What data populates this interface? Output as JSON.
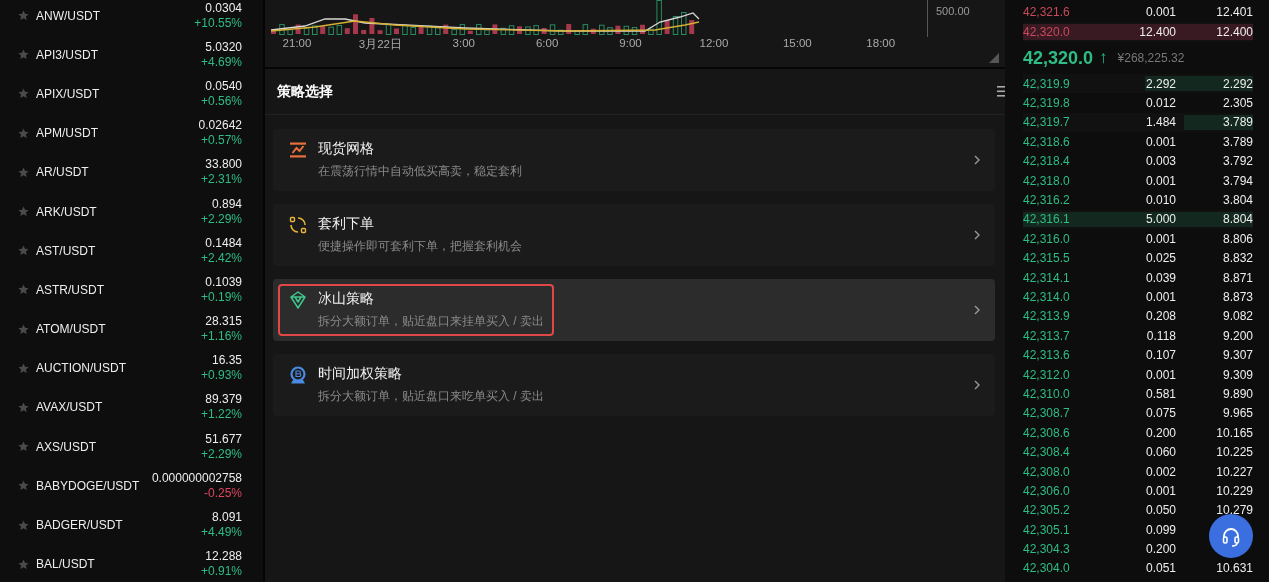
{
  "pairs": [
    {
      "name": "ANW/USDT",
      "price": "0.0304",
      "change": "+10.55%",
      "rising": true
    },
    {
      "name": "API3/USDT",
      "price": "5.0320",
      "change": "+4.69%",
      "rising": true
    },
    {
      "name": "APIX/USDT",
      "price": "0.0540",
      "change": "+0.56%",
      "rising": true
    },
    {
      "name": "APM/USDT",
      "price": "0.02642",
      "change": "+0.57%",
      "rising": true
    },
    {
      "name": "AR/USDT",
      "price": "33.800",
      "change": "+2.31%",
      "rising": true
    },
    {
      "name": "ARK/USDT",
      "price": "0.894",
      "change": "+2.29%",
      "rising": true
    },
    {
      "name": "AST/USDT",
      "price": "0.1484",
      "change": "+2.42%",
      "rising": true
    },
    {
      "name": "ASTR/USDT",
      "price": "0.1039",
      "change": "+0.19%",
      "rising": true
    },
    {
      "name": "ATOM/USDT",
      "price": "28.315",
      "change": "+1.16%",
      "rising": true
    },
    {
      "name": "AUCTION/USDT",
      "price": "16.35",
      "change": "+0.93%",
      "rising": true
    },
    {
      "name": "AVAX/USDT",
      "price": "89.379",
      "change": "+1.22%",
      "rising": true
    },
    {
      "name": "AXS/USDT",
      "price": "51.677",
      "change": "+2.29%",
      "rising": true
    },
    {
      "name": "BABYDOGE/USDT",
      "price": "0.000000002758",
      "change": "-0.25%",
      "rising": false
    },
    {
      "name": "BADGER/USDT",
      "price": "8.091",
      "change": "+4.49%",
      "rising": true
    },
    {
      "name": "BAL/USDT",
      "price": "12.288",
      "change": "+0.91%",
      "rising": true
    }
  ],
  "chart": {
    "y_label": "500.00",
    "x_labels": [
      "21:00",
      "3月22日",
      "3:00",
      "6:00",
      "9:00",
      "12:00",
      "15:00",
      "18:00"
    ]
  },
  "strategy_panel": {
    "title": "策略选择",
    "items": [
      {
        "kind": "grid",
        "color": "#e8703a",
        "title": "现货网格",
        "description": "在震荡行情中自动低买高卖，稳定套利",
        "selected": false,
        "outlined": false
      },
      {
        "kind": "arbitrage",
        "color": "#e8b43a",
        "title": "套利下单",
        "description": "便捷操作即可套利下单，把握套利机会",
        "selected": false,
        "outlined": false
      },
      {
        "kind": "iceberg",
        "color": "#3ec78f",
        "title": "冰山策略",
        "description": "拆分大额订单，贴近盘口来挂单买入 / 卖出",
        "selected": true,
        "outlined": true
      },
      {
        "kind": "twap",
        "color": "#4a8ae0",
        "title": "时间加权策略",
        "description": "拆分大额订单，贴近盘口来吃单买入 / 卖出",
        "selected": false,
        "outlined": false
      }
    ]
  },
  "order_book": {
    "asks": [
      {
        "price": "42,321.6",
        "amount": "0.001",
        "total": "12.401"
      },
      {
        "price": "42,320.0",
        "amount": "12.400",
        "total": "12.400",
        "level": 1
      }
    ],
    "last_price": {
      "value": "42,320.0",
      "arrow": "↑",
      "rising": true,
      "converted": "¥268,225.32"
    },
    "bids": [
      {
        "price": "42,319.9",
        "amount": "2.292",
        "total": "2.292",
        "level": 0.47
      },
      {
        "price": "42,319.8",
        "amount": "0.012",
        "total": "2.305"
      },
      {
        "price": "42,319.7",
        "amount": "1.484",
        "total": "3.789",
        "level": 0.3
      },
      {
        "price": "42,318.6",
        "amount": "0.001",
        "total": "3.789"
      },
      {
        "price": "42,318.4",
        "amount": "0.003",
        "total": "3.792"
      },
      {
        "price": "42,318.0",
        "amount": "0.001",
        "total": "3.794"
      },
      {
        "price": "42,316.2",
        "amount": "0.010",
        "total": "3.804"
      },
      {
        "price": "42,316.1",
        "amount": "5.000",
        "total": "8.804",
        "level": 1
      },
      {
        "price": "42,316.0",
        "amount": "0.001",
        "total": "8.806"
      },
      {
        "price": "42,315.5",
        "amount": "0.025",
        "total": "8.832"
      },
      {
        "price": "42,314.1",
        "amount": "0.039",
        "total": "8.871"
      },
      {
        "price": "42,314.0",
        "amount": "0.001",
        "total": "8.873"
      },
      {
        "price": "42,313.9",
        "amount": "0.208",
        "total": "9.082"
      },
      {
        "price": "42,313.7",
        "amount": "0.118",
        "total": "9.200"
      },
      {
        "price": "42,313.6",
        "amount": "0.107",
        "total": "9.307"
      },
      {
        "price": "42,312.0",
        "amount": "0.001",
        "total": "9.309"
      },
      {
        "price": "42,310.0",
        "amount": "0.581",
        "total": "9.890"
      },
      {
        "price": "42,308.7",
        "amount": "0.075",
        "total": "9.965"
      },
      {
        "price": "42,308.6",
        "amount": "0.200",
        "total": "10.165"
      },
      {
        "price": "42,308.4",
        "amount": "0.060",
        "total": "10.225"
      },
      {
        "price": "42,308.0",
        "amount": "0.002",
        "total": "10.227"
      },
      {
        "price": "42,306.0",
        "amount": "0.001",
        "total": "10.229"
      },
      {
        "price": "42,305.2",
        "amount": "0.050",
        "total": "10.279"
      },
      {
        "price": "42,305.1",
        "amount": "0.099"
      },
      {
        "price": "42,304.3",
        "amount": "0.200"
      },
      {
        "price": "42,304.0",
        "amount": "0.051",
        "total": "10.631"
      }
    ]
  }
}
